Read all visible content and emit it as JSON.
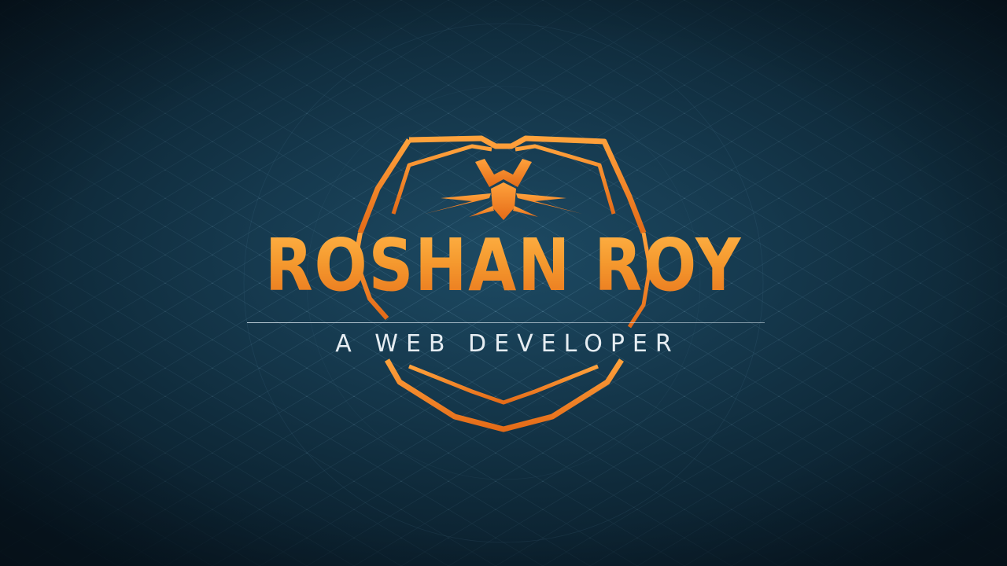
{
  "logo": {
    "name": "ROSHAN ROY",
    "tagline": "A WEB DEVELOPER",
    "emblem_icon": "spider-icon"
  },
  "colors": {
    "background": "#163a4f",
    "accent": "#f08a2a",
    "tagline": "#e6edf2",
    "divider": "#c8d7e1"
  }
}
